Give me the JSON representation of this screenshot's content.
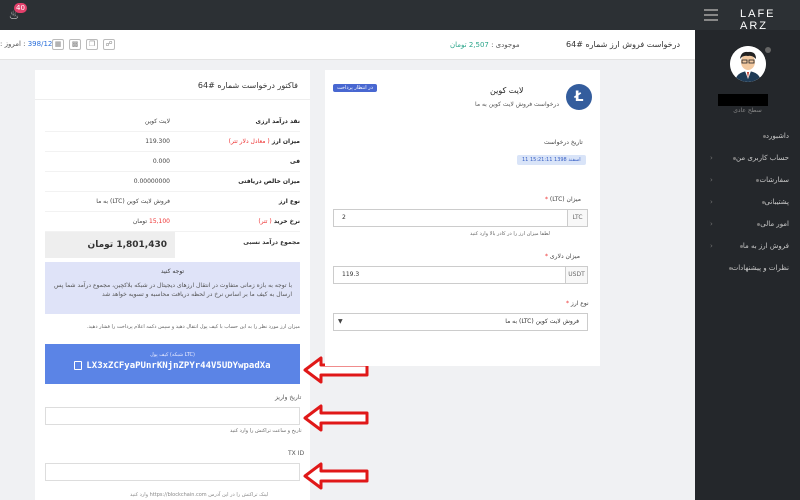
{
  "topbar": {
    "logo": "LAFE ARZ",
    "notification_count": "40"
  },
  "sidebar": {
    "role": "سطح عادی",
    "items": [
      {
        "label": "داشبورد",
        "chevron": ""
      },
      {
        "label": "حساب کاربری من",
        "chevron": "‹"
      },
      {
        "label": "سفارشات",
        "chevron": "‹"
      },
      {
        "label": "پشتیبانی",
        "chevron": "‹"
      },
      {
        "label": "امور مالی",
        "chevron": "‹"
      },
      {
        "label": "فروش ارز به ما",
        "chevron": "‹"
      },
      {
        "label": "نظرات و پیشنهادات",
        "chevron": ""
      }
    ]
  },
  "header": {
    "title": "درخواست فروش ارز شماره #64",
    "balance_label": "موجودی :",
    "balance_value": "2,507 تومان",
    "today_label": "امروز :",
    "today_value": "398/12/11"
  },
  "invoice": {
    "title": "فاکتور درخواست شماره #64",
    "rows": [
      {
        "key": "نقد درآمد ارزی",
        "value": "لایت کوین"
      },
      {
        "key": "میزان ارز",
        "key_note": "( معادل دلار تتر)",
        "value": "119.300"
      },
      {
        "key": "فی",
        "value": "0.000"
      },
      {
        "key": "میزان خالص دریافتی",
        "value": "0.00000000"
      },
      {
        "key": "نوع ارز",
        "value": "فروش لایت کوین (LTC) به ما"
      },
      {
        "key": "نرخ خرید",
        "key_note": "( تتر)",
        "value": "15,100",
        "value_unit": "تومان"
      }
    ],
    "total_label": "مجموع درآمد نسبی",
    "total_value": "1,801,430 تومان"
  },
  "notice": {
    "title": "توجه کنید",
    "text": "با توجه به بازه زمانی متفاوت در انتقال ارزهای دیجیتال در شبکه بلاکچین، مجموع درآمد شما پس ارسال به کیف ما بر اساس نرخ در لحظه دریافت محاسبه و تسویه خواهد شد"
  },
  "help_text": "میزان ارز مورد نظر را به این حساب با کیف پول انتقال دهید و سپس دکمه اعلام پرداخت را فشار دهید.",
  "wallet": {
    "label": "کیف پول (شبکه LTC)",
    "address": "LX3xZCFyaPUnrKNjnZPYr44V5UDYwpadXa"
  },
  "fields": {
    "payment_date_label": "تاریخ واریز",
    "payment_date_help": "تاریخ و ساعت تراکنش را وارد کنید",
    "txid_label": "TX ID"
  },
  "footer_note": "لینک تراکنش را در این آدرس https://blockchain.com وارد کنید",
  "coin": {
    "title": "لایت کوین",
    "subtitle": "درخواست فروش لایت کوین به ما",
    "symbol": "Ł",
    "status": "در انتظار پرداخت",
    "date_label": "تاریخ درخواست",
    "date_value": "11 اسفند 1398 15:21:11"
  },
  "form": {
    "amount_label": "میزان (LTC)",
    "amount_value": "2",
    "amount_unit": "LTC",
    "amount_help": "لطفا میزان ارز را در کادر بالا وارد کنید",
    "dollar_label": "میزان دلاری",
    "dollar_value": "119.3",
    "dollar_unit": "USDT",
    "type_label": "نوع ارز",
    "type_value": "فروش لایت کوین (LTC) به ما",
    "required_mark": "*"
  },
  "colors": {
    "accent": "#5b84e6",
    "arrow": "#e01818",
    "sidebar": "#24272b",
    "topbar": "#2c3034"
  }
}
